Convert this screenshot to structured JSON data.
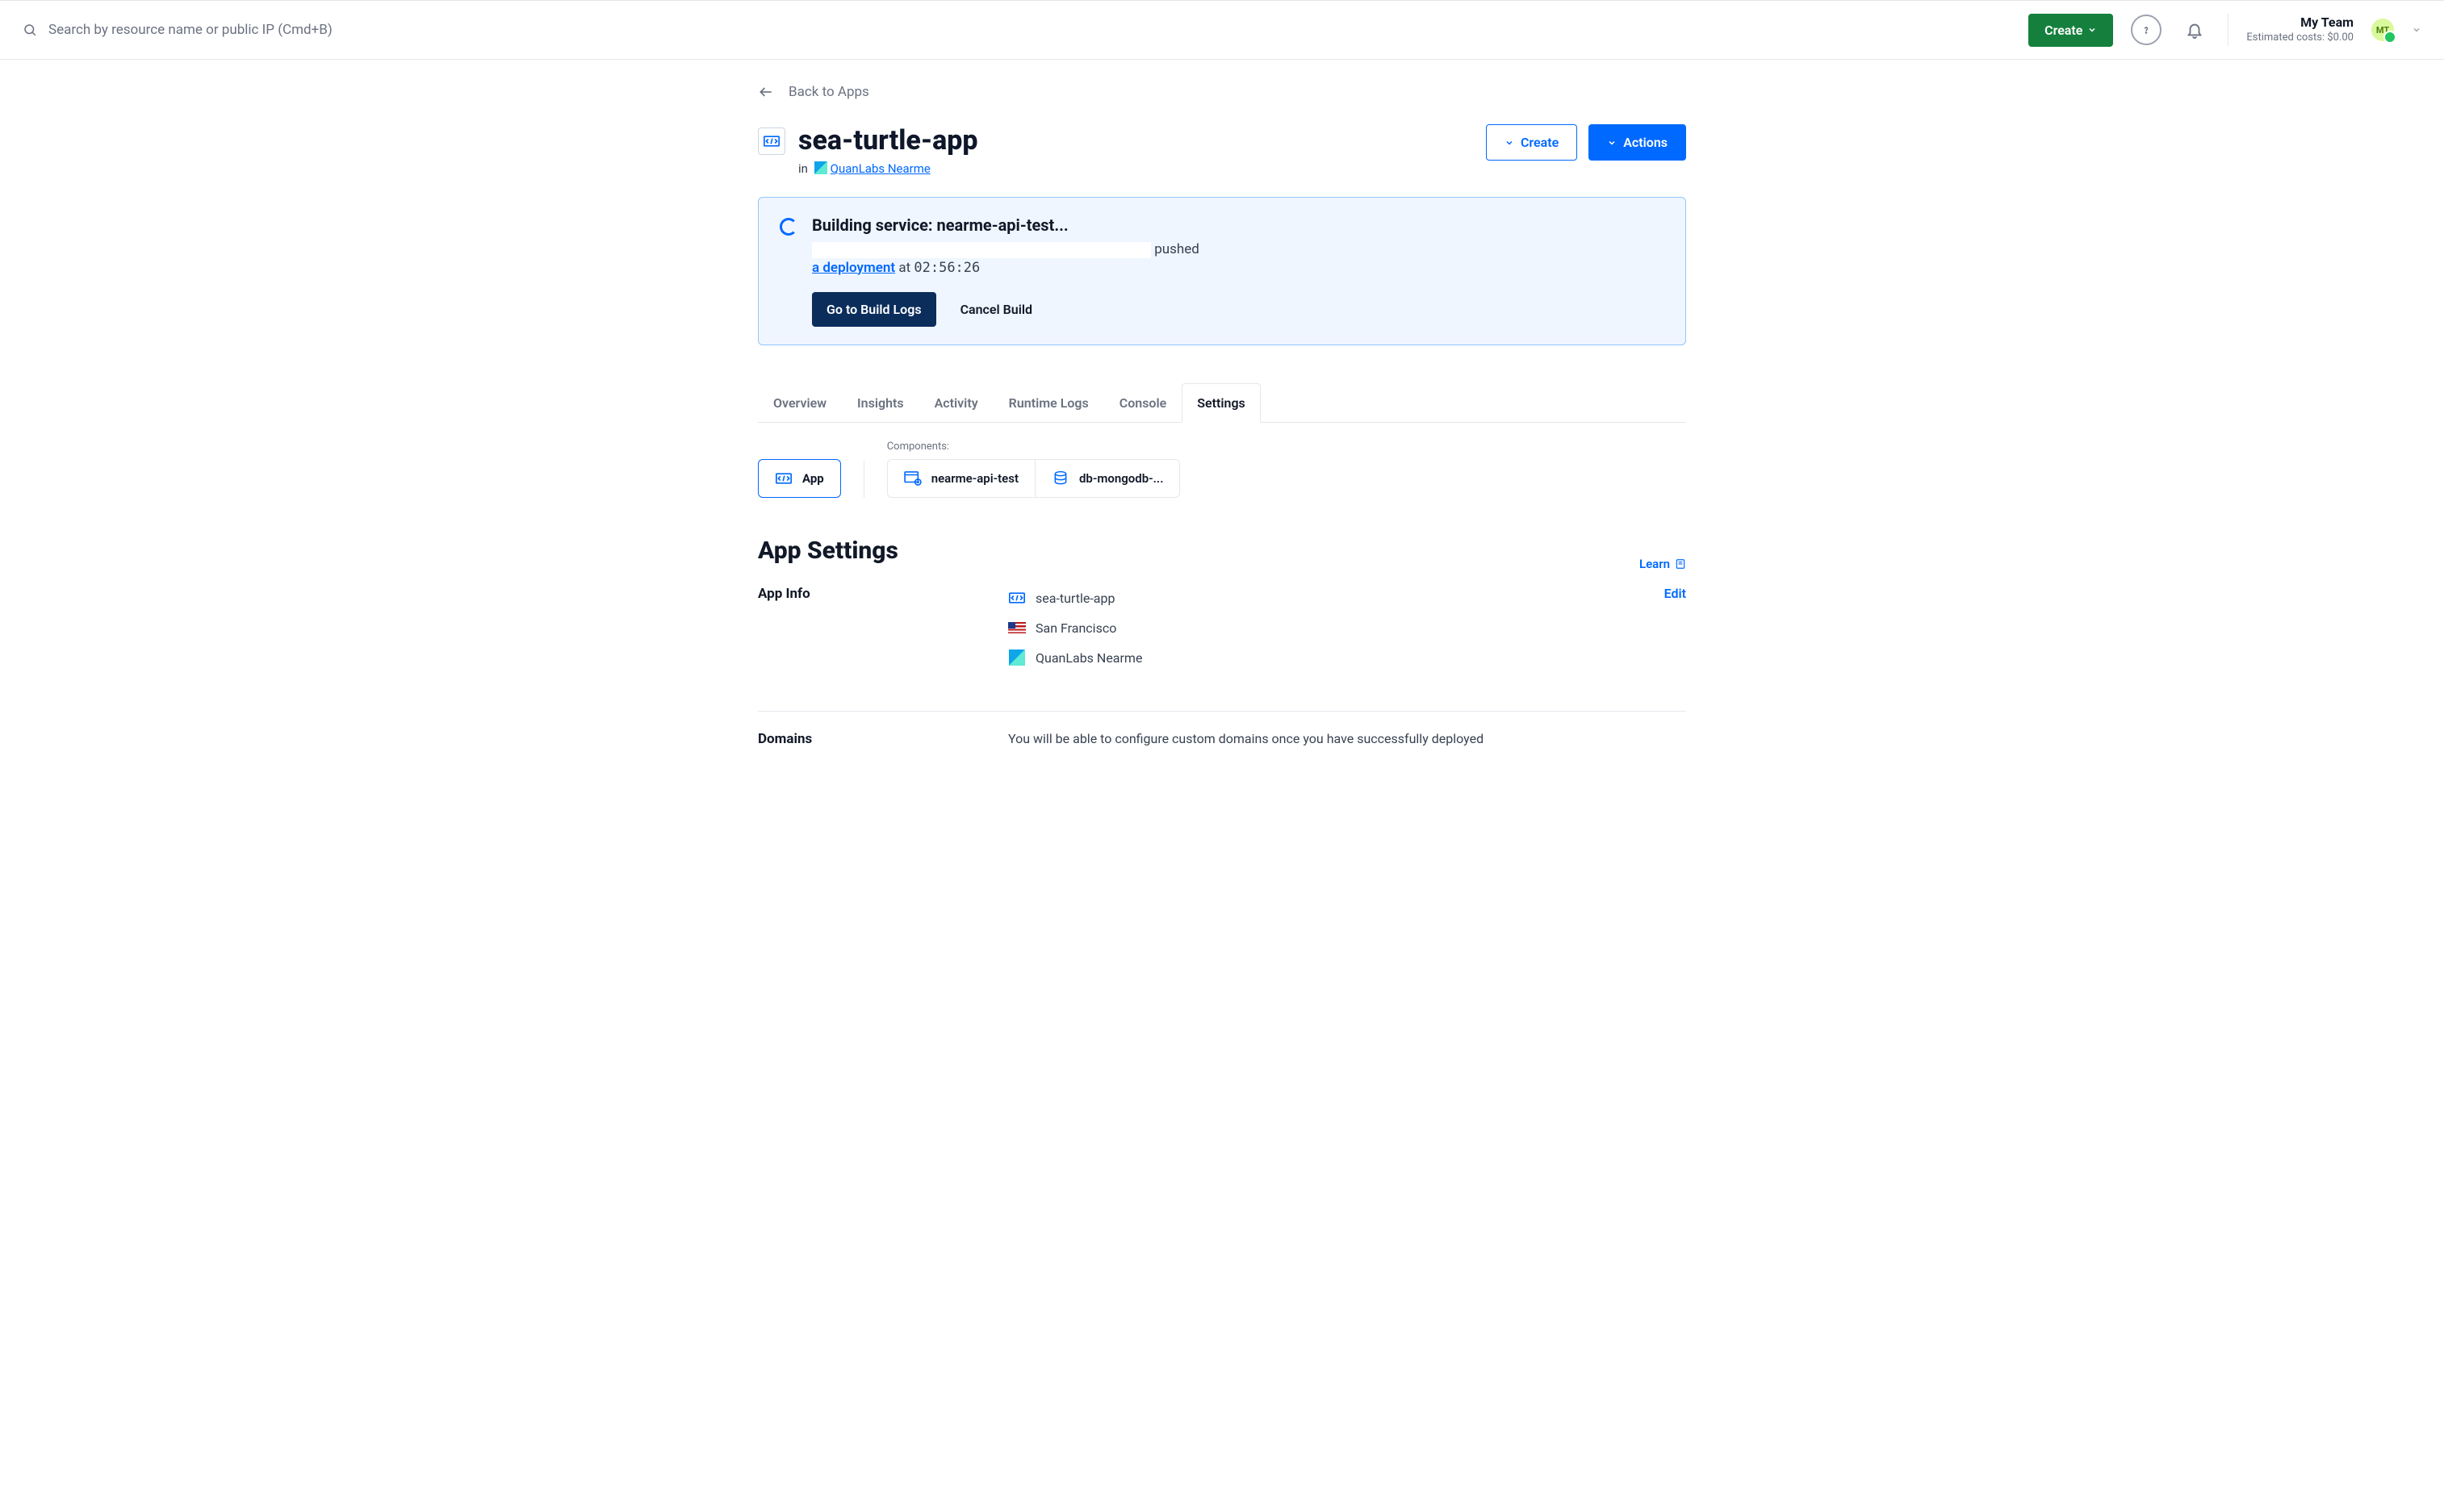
{
  "topbar": {
    "search_placeholder": "Search by resource name or public IP (Cmd+B)",
    "create_label": "Create",
    "team_name": "My Team",
    "team_cost": "Estimated costs: $0.00",
    "avatar_initials": "MT"
  },
  "back_link": "Back to Apps",
  "app": {
    "name": "sea-turtle-app",
    "in_prefix": "in",
    "project": "QuanLabs Nearme"
  },
  "header_buttons": {
    "create": "Create",
    "actions": "Actions"
  },
  "banner": {
    "title": "Building service: nearme-api-test...",
    "pushed_suffix": "pushed",
    "deployment_link": "a deployment",
    "at_word": "at",
    "time": "02:56:26",
    "go_logs": "Go to Build Logs",
    "cancel": "Cancel Build"
  },
  "tabs": [
    "Overview",
    "Insights",
    "Activity",
    "Runtime Logs",
    "Console",
    "Settings"
  ],
  "active_tab": "Settings",
  "components": {
    "app_pill": "App",
    "components_label": "Components:",
    "items": [
      "nearme-api-test",
      "db-mongodb-..."
    ]
  },
  "settings": {
    "heading": "App Settings",
    "learn": "Learn",
    "app_info": {
      "label": "App Info",
      "name": "sea-turtle-app",
      "region": "San Francisco",
      "project": "QuanLabs Nearme",
      "edit": "Edit"
    },
    "domains": {
      "label": "Domains",
      "desc": "You will be able to configure custom domains once you have successfully deployed"
    }
  }
}
